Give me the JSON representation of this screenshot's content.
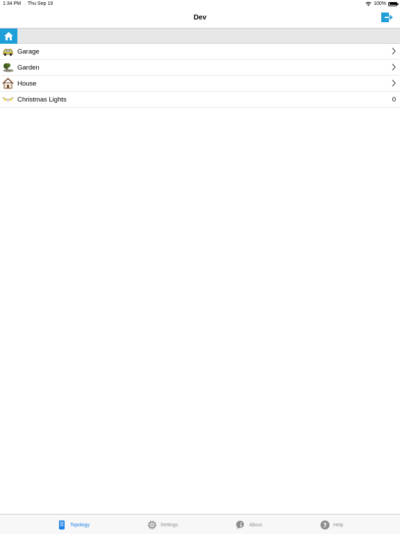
{
  "status_bar": {
    "time": "1:34 PM",
    "date": "Thu Sep 19",
    "battery": "100%"
  },
  "nav": {
    "title": "Dev",
    "logout_icon": "logout-icon"
  },
  "breadcrumb": {
    "home_icon": "home-icon"
  },
  "list": {
    "items": [
      {
        "label": "Garage",
        "icon": "car-icon",
        "accessory": "chevron"
      },
      {
        "label": "Garden",
        "icon": "garden-icon",
        "accessory": "chevron"
      },
      {
        "label": "House",
        "icon": "house-icon",
        "accessory": "chevron"
      },
      {
        "label": "Christmas Lights",
        "icon": "lights-icon",
        "value": "0"
      }
    ]
  },
  "tabs": [
    {
      "label": "Topology",
      "icon": "topology-icon",
      "active": true
    },
    {
      "label": "Settings",
      "icon": "gear-icon",
      "active": false
    },
    {
      "label": "About",
      "icon": "info-icon",
      "active": false
    },
    {
      "label": "Help",
      "icon": "help-icon",
      "active": false
    }
  ],
  "colors": {
    "accent": "#1f9fd8",
    "tab_active": "#1a7fe6",
    "tab_inactive": "#8e8e8e"
  }
}
